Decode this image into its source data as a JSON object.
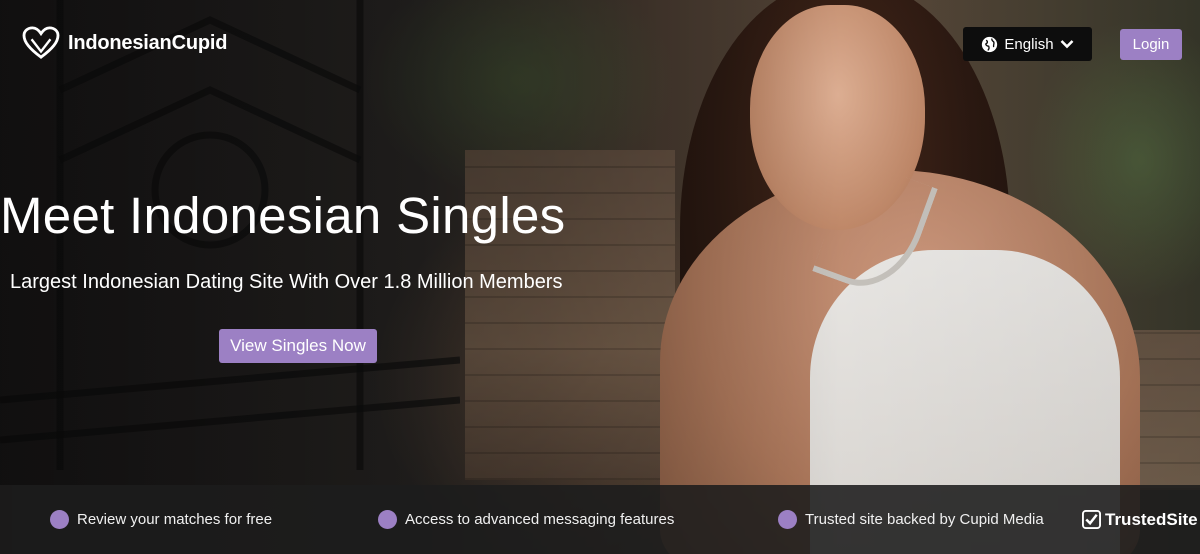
{
  "header": {
    "logo": {
      "brand_primary": "Indonesian",
      "brand_accent": "Cupid",
      "icon": "heart-logo-icon"
    },
    "language": {
      "label": "English",
      "icon": "globe-icon",
      "dropdown_icon": "chevron-down-icon"
    },
    "login_label": "Login"
  },
  "hero": {
    "title": "Meet Indonesian Singles",
    "subtitle": "Largest Indonesian Dating Site With Over 1.8 Million Members",
    "cta_label": "View Singles Now"
  },
  "features": [
    {
      "label": "Review your matches for free"
    },
    {
      "label": "Access to advanced messaging features"
    },
    {
      "label": "Trusted site backed by Cupid Media"
    }
  ],
  "trust_badge": {
    "label": "TrustedSite",
    "mark": "®",
    "icon": "checkmark-shield-icon"
  },
  "colors": {
    "accent": "#9c80c4",
    "lang_button_bg": "#0d0d0d",
    "features_bar_bg": "#1c1c1c"
  }
}
